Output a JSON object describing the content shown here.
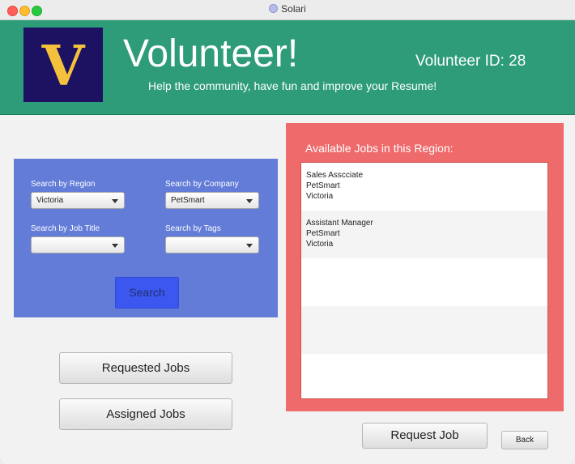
{
  "window": {
    "title": "Solari"
  },
  "header": {
    "logo_letter": "V",
    "title": "Volunteer!",
    "volunteer_id": "Volunteer ID: 28",
    "tagline": "Help the community, have fun and improve your Resume!"
  },
  "search": {
    "region_label": "Search by Region",
    "region_value": "Victoria",
    "company_label": "Search by Company",
    "company_value": "PetSmart",
    "title_label": "Search by Job Title",
    "title_value": "",
    "tags_label": "Search by Tags",
    "tags_value": "",
    "button": "Search"
  },
  "nav": {
    "requested_jobs": "Requested Jobs",
    "assigned_jobs": "Assigned Jobs"
  },
  "jobs": {
    "title": "Available Jobs in this Region:",
    "items": [
      {
        "title": "Sales Asscciate",
        "company": "PetSmart",
        "region": "Victoria"
      },
      {
        "title": "Assistant Manager",
        "company": "PetSmart",
        "region": "Victoria"
      }
    ]
  },
  "actions": {
    "request_job": "Request Job",
    "back": "Back"
  },
  "colors": {
    "header": "#2e9c79",
    "logo_bg": "#1d1161",
    "logo_letter": "#f4c13c",
    "search_panel": "#627cd8",
    "search_button": "#3b57f0",
    "jobs_panel": "#ef6a6b"
  }
}
